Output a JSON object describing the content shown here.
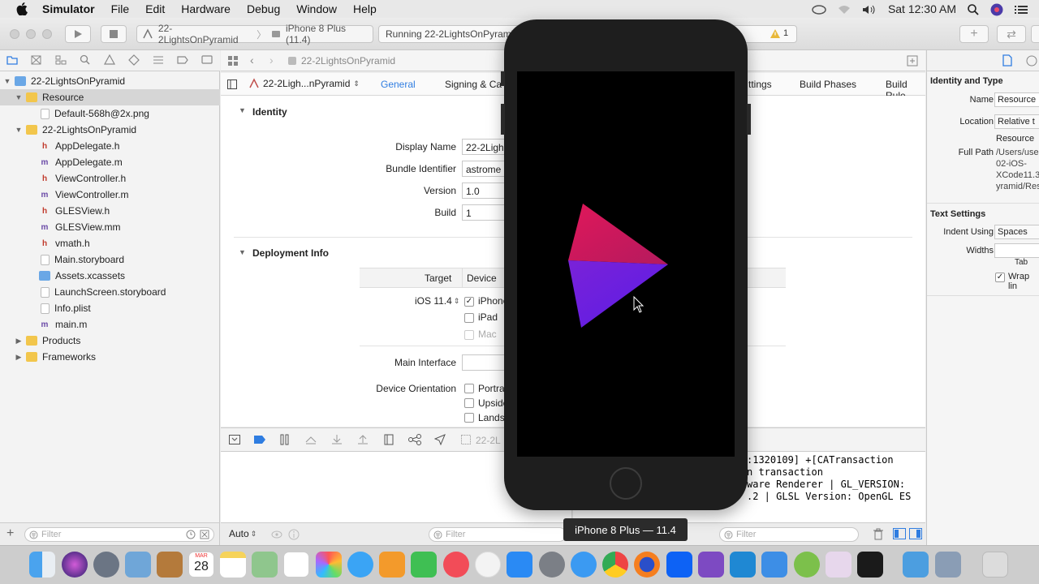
{
  "menubar": {
    "app_name": "Simulator",
    "items": [
      "File",
      "Edit",
      "Hardware",
      "Debug",
      "Window",
      "Help"
    ],
    "clock": "Sat 12:30 AM"
  },
  "toolbar": {
    "scheme_project": "22-2LightsOnPyramid",
    "scheme_device": "iPhone 8 Plus (11.4)",
    "activity_text": "Running 22-2LightsOnPyramid",
    "warning_count": "1"
  },
  "navigator": {
    "items": [
      {
        "label": "22-2LightsOnPyramid",
        "kind": "project"
      },
      {
        "label": "Resource",
        "kind": "folder"
      },
      {
        "label": "Default-568h@2x.png",
        "kind": "png"
      },
      {
        "label": "22-2LightsOnPyramid",
        "kind": "folder"
      },
      {
        "label": "AppDelegate.h",
        "kind": "h"
      },
      {
        "label": "AppDelegate.m",
        "kind": "m"
      },
      {
        "label": "ViewController.h",
        "kind": "h"
      },
      {
        "label": "ViewController.m",
        "kind": "m"
      },
      {
        "label": "GLESView.h",
        "kind": "h"
      },
      {
        "label": "GLESView.mm",
        "kind": "m"
      },
      {
        "label": "vmath.h",
        "kind": "h"
      },
      {
        "label": "Main.storyboard",
        "kind": "doc"
      },
      {
        "label": "Assets.xcassets",
        "kind": "blue"
      },
      {
        "label": "LaunchScreen.storyboard",
        "kind": "doc"
      },
      {
        "label": "Info.plist",
        "kind": "doc"
      },
      {
        "label": "main.m",
        "kind": "m"
      },
      {
        "label": "Products",
        "kind": "folder"
      },
      {
        "label": "Frameworks",
        "kind": "folder"
      }
    ],
    "filter_placeholder": "Filter"
  },
  "editor": {
    "jump_path": "22-2LightsOnPyramid",
    "target_name": "22-2Ligh...nPyramid",
    "tabs": [
      "General",
      "Signing & Ca",
      "ttings",
      "Build Phases",
      "Build Rule"
    ],
    "identity": {
      "heading": "Identity",
      "display_name_label": "Display Name",
      "display_name_value": "22-2Ligh",
      "bundle_label": "Bundle Identifier",
      "bundle_value": "astrome",
      "version_label": "Version",
      "version_value": "1.0",
      "build_label": "Build",
      "build_value": "1"
    },
    "deployment": {
      "heading": "Deployment Info",
      "col_target": "Target",
      "col_device": "Device",
      "ios_version": "iOS 11.4",
      "device_iphone": "iPhone",
      "device_ipad": "iPad",
      "device_mac": "Mac",
      "main_interface_label": "Main Interface",
      "orientation_label": "Device Orientation",
      "orient_portrait": "Portra",
      "orient_upside": "Upside",
      "orient_landscape": "Landsc"
    }
  },
  "debug": {
    "breadcrumb": "22-2L",
    "console_lines": [
      ":1320109] +[CATransaction",
      "n transaction",
      "ware Renderer | GL_VERSION:",
      ".2 | GLSL Version: OpenGL ES"
    ],
    "auto_label": "Auto",
    "filter_placeholder_left": "Filter",
    "filter_placeholder_right": "Filter"
  },
  "inspector": {
    "identity_heading": "Identity and Type",
    "name_label": "Name",
    "name_value": "Resource",
    "location_label": "Location",
    "location_value": "Relative t",
    "location_sub": "Resource",
    "fullpath_label": "Full Path",
    "fullpath_value": [
      "/Users/use",
      "02-iOS-",
      "XCode11.3",
      "yramid/Res"
    ],
    "text_heading": "Text Settings",
    "indent_label": "Indent Using",
    "indent_value": "Spaces",
    "widths_label": "Widths",
    "tab_label": "Tab",
    "wrap_label": "Wrap lin"
  },
  "simulator": {
    "label": "iPhone 8 Plus — 11.4",
    "colors": {
      "top_face": "#d81b4f",
      "bottom_face": "#6a1fe0"
    }
  },
  "dock": {
    "apps": [
      "finder-icon",
      "siri-icon",
      "launchpad-icon",
      "preview-icon",
      "notebook-icon",
      "calendar-icon",
      "notes-icon",
      "maps-icon",
      "reminders-icon",
      "photos-icon",
      "messages-icon",
      "pages-icon",
      "numbers-icon",
      "news-icon",
      "music-icon",
      "appstore-icon",
      "sysprefs-icon",
      "safari-icon",
      "chrome-icon",
      "firefox-icon",
      "dropbox-icon",
      "visualstudio-icon",
      "vscode-icon",
      "xcode-icon",
      "android-studio-icon",
      "inkscape-icon",
      "terminal-icon",
      "files-icon",
      "migration-icon",
      "trash-icon"
    ],
    "calendar_month": "MAR",
    "calendar_day": "28"
  }
}
